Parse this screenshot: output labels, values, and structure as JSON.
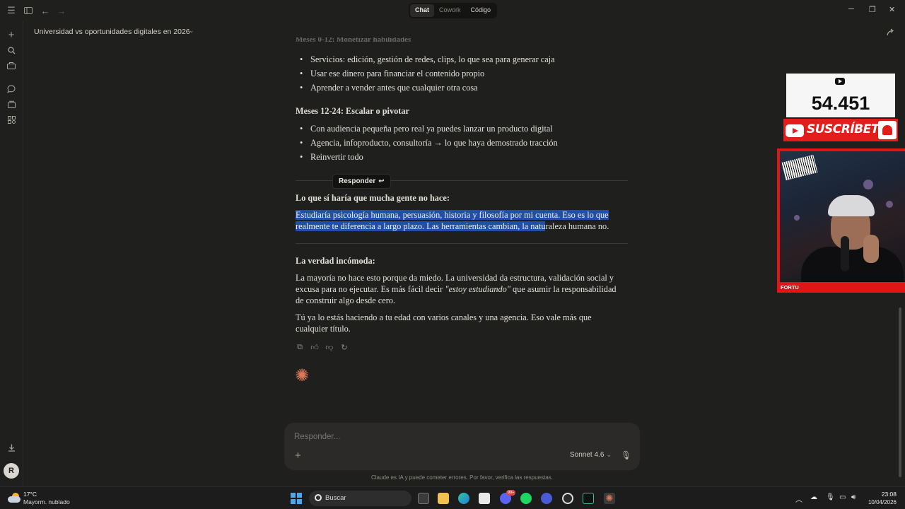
{
  "titlebar": {
    "modes": [
      "Chat",
      "Cowork",
      "Código"
    ],
    "active_mode": "Chat",
    "window_controls": [
      "minimize-icon",
      "restore-icon",
      "close-icon"
    ]
  },
  "sidebar": {
    "icons": [
      "new-chat-icon",
      "search-icon",
      "projects-icon",
      "chats-icon",
      "artifacts-icon",
      "apps-icon"
    ],
    "download_icon": "download-icon",
    "avatar_initial": "R"
  },
  "conversation": {
    "title": "Universidad vs oportunidades digitales en 2026"
  },
  "message": {
    "faded_heading": "Meses 0-12: Monetizar habilidades",
    "bullets_1": [
      "Servicios: edición, gestión de redes, clips, lo que sea para generar caja",
      "Usar ese dinero para financiar el contenido propio",
      "Aprender a vender antes que cualquier otra cosa"
    ],
    "heading_2": "Meses 12-24: Escalar o pivotar",
    "bullets_2": [
      "Con audiencia pequeña pero real ya puedes lanzar un producto digital",
      "Agencia, infoproducto, consultoría → lo que haya demostrado tracción",
      "Reinvertir todo"
    ],
    "reply_pill": "Responder",
    "heading_3": "Lo que sí haría que mucha gente no hace:",
    "para_3_line1": "Estudiaría psicología humana, persuasión, historia y filosofía por mi cuenta. Eso es lo que",
    "para_3_line2_hl": "realmente te diferencia a largo plazo. Las herramientas cambian, la natu",
    "para_3_line2_rest": "raleza humana no.",
    "heading_4": "La verdad incómoda:",
    "para_4_a": "La mayoría no hace esto porque da miedo. La universidad da estructura, validación social y excusa para no ejecutar. Es más fácil decir ",
    "para_4_em": "\"estoy estudiando\"",
    "para_4_b": " que asumir la responsabilidad de construir algo desde cero.",
    "para_5": "Tú ya lo estás haciendo a tu edad con varios canales y una agencia. Eso vale más que cualquier título.",
    "action_icons": [
      "copy-icon",
      "thumbs-up-icon",
      "thumbs-down-icon",
      "retry-icon"
    ]
  },
  "composer": {
    "placeholder": "Responder...",
    "model": "Sonnet 4.6",
    "disclaimer": "Claude es IA y puede cometer errores. Por favor, verifica las respuestas."
  },
  "overlay": {
    "subscriber_count": "54.451",
    "subscribe_label": "SUSCRÍBETE",
    "streamer_name": "FORTU"
  },
  "taskbar": {
    "temperature": "17°C",
    "weather": "Mayorm. nublado",
    "search_label": "Buscar",
    "badge": "99+",
    "time": "23:08",
    "date": "10/04/2026"
  }
}
